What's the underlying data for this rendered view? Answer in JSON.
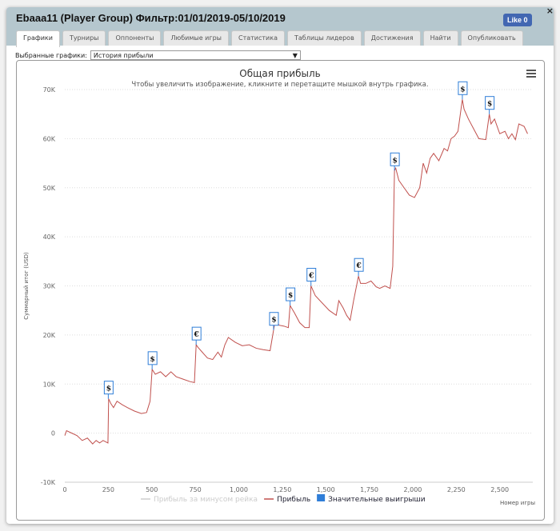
{
  "window": {
    "title": "Ebaaa11 (Player Group) Фильтр:01/01/2019-05/10/2019",
    "like_label": "Like 0",
    "close": "×"
  },
  "tabs": [
    {
      "label": "Графики",
      "active": true
    },
    {
      "label": "Турниры"
    },
    {
      "label": "Оппоненты"
    },
    {
      "label": "Любимые игры"
    },
    {
      "label": "Статистика"
    },
    {
      "label": "Таблицы лидеров"
    },
    {
      "label": "Достижения"
    },
    {
      "label": "Найти"
    },
    {
      "label": "Опубликовать"
    }
  ],
  "selector": {
    "label": "Выбранные графики:",
    "value": "История прибыли",
    "arrow": "▼"
  },
  "chart_data": {
    "type": "line",
    "title": "Общая прибыль",
    "subtitle": "Чтобы увеличить изображение, кликните и перетащите мышкой внутрь графика.",
    "xlabel": "Номер игры",
    "ylabel": "Суммарный итог (USD)",
    "xlim": [
      0,
      2690
    ],
    "ylim": [
      -10000,
      70000
    ],
    "xticks": [
      0,
      250,
      500,
      750,
      1000,
      1250,
      1500,
      1750,
      2000,
      2250,
      2500
    ],
    "xtick_labels": [
      "0",
      "250",
      "500",
      "750",
      "1,000",
      "1,250",
      "1,500",
      "1,750",
      "2,000",
      "2,250",
      "2,500"
    ],
    "yticks": [
      -10000,
      0,
      10000,
      20000,
      30000,
      40000,
      50000,
      60000,
      70000
    ],
    "ytick_labels": [
      "-10K",
      "0",
      "10K",
      "20K",
      "30K",
      "40K",
      "50K",
      "60K",
      "70K"
    ],
    "grid": true,
    "legend": "bottom",
    "line_color": "#c0504d",
    "flag_color": "#2f7ed8",
    "series": [
      {
        "name": "Прибыль",
        "x": [
          0,
          10,
          40,
          70,
          100,
          130,
          160,
          180,
          200,
          220,
          248,
          252,
          265,
          280,
          300,
          330,
          360,
          400,
          440,
          470,
          490,
          502,
          520,
          550,
          580,
          610,
          640,
          680,
          720,
          745,
          755,
          765,
          790,
          820,
          850,
          880,
          900,
          920,
          940,
          980,
          1020,
          1060,
          1100,
          1140,
          1180,
          1200,
          1215,
          1230,
          1260,
          1285,
          1295,
          1320,
          1350,
          1380,
          1405,
          1415,
          1440,
          1480,
          1520,
          1560,
          1575,
          1600,
          1620,
          1640,
          1660,
          1688,
          1700,
          1730,
          1760,
          1790,
          1810,
          1840,
          1870,
          1885,
          1895,
          1902,
          1920,
          1950,
          1980,
          2010,
          2040,
          2060,
          2080,
          2100,
          2120,
          2150,
          2180,
          2200,
          2220,
          2240,
          2260,
          2285,
          2295,
          2320,
          2350,
          2380,
          2420,
          2440,
          2450,
          2470,
          2500,
          2530,
          2550,
          2570,
          2590,
          2610,
          2640,
          2660
        ],
        "y": [
          -500,
          500,
          0,
          -500,
          -1500,
          -1000,
          -2200,
          -1500,
          -2000,
          -1500,
          -2000,
          7000,
          6000,
          5200,
          6500,
          5800,
          5200,
          4500,
          4000,
          4200,
          6500,
          13000,
          12000,
          12500,
          11500,
          12500,
          11500,
          11000,
          10500,
          10300,
          18000,
          17500,
          16500,
          15300,
          15000,
          16500,
          15500,
          18000,
          19500,
          18500,
          17800,
          18000,
          17300,
          17000,
          16800,
          21000,
          24000,
          22000,
          21800,
          21500,
          26000,
          24500,
          22500,
          21500,
          21500,
          30000,
          28000,
          26500,
          25000,
          24000,
          27000,
          25500,
          24000,
          23000,
          27000,
          32000,
          30500,
          30500,
          31000,
          29800,
          29500,
          30000,
          29500,
          34000,
          53500,
          54000,
          51500,
          50000,
          48500,
          48000,
          50000,
          55000,
          53000,
          56000,
          57000,
          55500,
          58000,
          57500,
          60000,
          60500,
          61500,
          68000,
          66000,
          64000,
          62000,
          60000,
          59800,
          65000,
          63000,
          64000,
          61000,
          61500,
          60000,
          61000,
          59800,
          63000,
          62500,
          61000
        ]
      }
    ],
    "flags": [
      {
        "x": 250,
        "y": 7000,
        "label": "$"
      },
      {
        "x": 502,
        "y": 13000,
        "label": "$"
      },
      {
        "x": 755,
        "y": 18000,
        "label": "€"
      },
      {
        "x": 1200,
        "y": 21000,
        "label": "$"
      },
      {
        "x": 1295,
        "y": 26000,
        "label": "$"
      },
      {
        "x": 1415,
        "y": 30000,
        "label": "€"
      },
      {
        "x": 1688,
        "y": 32000,
        "label": "€"
      },
      {
        "x": 1895,
        "y": 53500,
        "label": "$"
      },
      {
        "x": 2285,
        "y": 68000,
        "label": "$"
      },
      {
        "x": 2440,
        "y": 65000,
        "label": "$"
      }
    ],
    "legend_items": [
      {
        "name": "Прибыль за минусом рейка",
        "color": "#cccccc",
        "hidden": true
      },
      {
        "name": "Прибыль",
        "color": "#c0504d"
      },
      {
        "name": "Значительные выигрыши",
        "color": "#2f7ed8"
      }
    ],
    "menu_icon": "hamburger-icon"
  }
}
